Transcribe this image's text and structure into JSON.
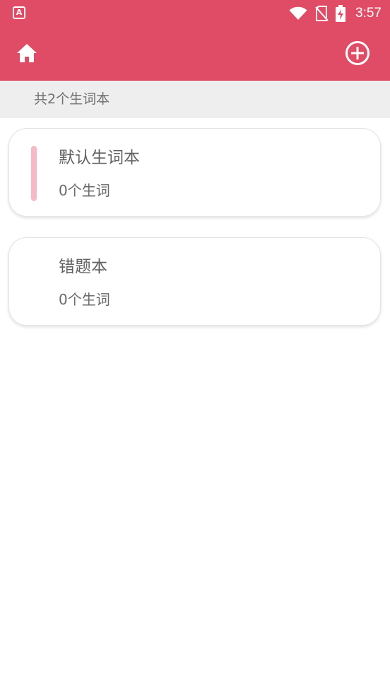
{
  "status_bar": {
    "app_icon_letter": "A",
    "time": "3:57"
  },
  "toolbar": {
    "home_icon": "home-icon",
    "add_icon": "add-circle-icon"
  },
  "summary": {
    "text": "共2个生词本"
  },
  "notebooks": [
    {
      "title": "默认生词本",
      "count": "0个生词",
      "accent_color": "#f6b9c5",
      "selected": true
    },
    {
      "title": "错题本",
      "count": "0个生词",
      "selected": false
    }
  ],
  "colors": {
    "primary": "#e04b65",
    "summary_background": "#eeeeee"
  }
}
